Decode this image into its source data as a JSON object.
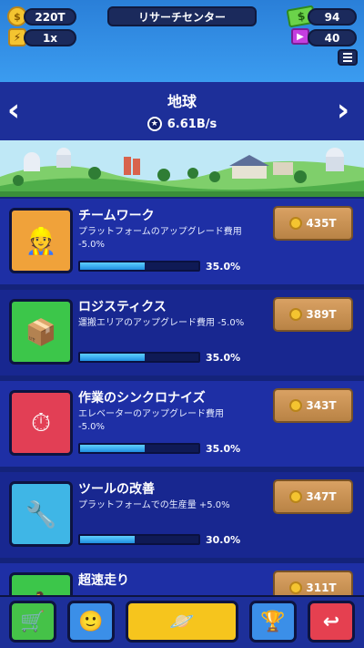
{
  "hud": {
    "coins": "220T",
    "multiplier": "1x",
    "title": "リサーチセンター",
    "cash": "94",
    "gems": "40"
  },
  "planet": {
    "name": "地球",
    "rate": "6.61B/s"
  },
  "upgrades": [
    {
      "title": "チームワーク",
      "desc": "プラットフォームのアップグレード費用 -5.0%",
      "progress_pct": "35.0%",
      "progress": 0.35,
      "cost": "435T",
      "icon": "team-icon"
    },
    {
      "title": "ロジスティクス",
      "desc": "運搬エリアのアップグレード費用 -5.0%",
      "progress_pct": "35.0%",
      "progress": 0.35,
      "cost": "389T",
      "icon": "boxes-icon"
    },
    {
      "title": "作業のシンクロナイズ",
      "desc": "エレベーターのアップグレード費用 -5.0%",
      "progress_pct": "35.0%",
      "progress": 0.35,
      "cost": "343T",
      "icon": "stopwatch-icon"
    },
    {
      "title": "ツールの改善",
      "desc": "プラットフォームでの生産量 +5.0%",
      "progress_pct": "30.0%",
      "progress": 0.3,
      "cost": "347T",
      "icon": "tools-icon"
    },
    {
      "title": "超速走り",
      "desc": "",
      "progress_pct": "",
      "progress": 0,
      "cost": "311T",
      "icon": "runner-icon"
    }
  ],
  "nav": {
    "items": [
      "shop-icon",
      "manager-icon",
      "planet-icon",
      "trophy-icon",
      "exit-icon"
    ]
  }
}
